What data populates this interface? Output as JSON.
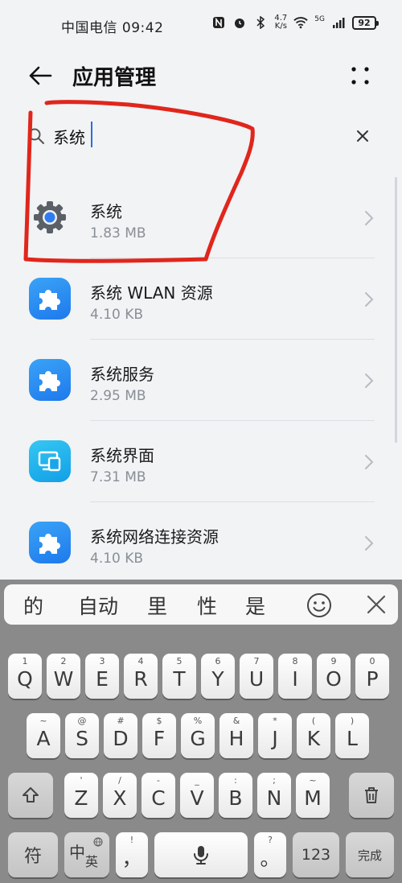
{
  "status_bar": {
    "carrier_time": "中国电信 09:42",
    "net_speed_value": "4.7",
    "net_speed_unit": "K/s",
    "signal_type": "5G",
    "battery": "92"
  },
  "app_bar": {
    "title": "应用管理"
  },
  "search": {
    "value": "系统"
  },
  "apps": [
    {
      "name": "系统",
      "size": "1.83 MB",
      "icon": "gear-icon"
    },
    {
      "name": "系统 WLAN 资源",
      "size": "4.10 KB",
      "icon": "puzzle-icon"
    },
    {
      "name": "系统服务",
      "size": "2.95 MB",
      "icon": "puzzle-icon"
    },
    {
      "name": "系统界面",
      "size": "7.31 MB",
      "icon": "screens-icon"
    },
    {
      "name": "系统网络连接资源",
      "size": "4.10 KB",
      "icon": "puzzle-icon"
    }
  ],
  "keyboard": {
    "candidates": [
      "的",
      "自动",
      "里",
      "性",
      "是"
    ],
    "row1": [
      {
        "main": "Q",
        "sub": "1"
      },
      {
        "main": "W",
        "sub": "2"
      },
      {
        "main": "E",
        "sub": "3"
      },
      {
        "main": "R",
        "sub": "4"
      },
      {
        "main": "T",
        "sub": "5"
      },
      {
        "main": "Y",
        "sub": "6"
      },
      {
        "main": "U",
        "sub": "7"
      },
      {
        "main": "I",
        "sub": "8"
      },
      {
        "main": "O",
        "sub": "9"
      },
      {
        "main": "P",
        "sub": "0"
      }
    ],
    "row2": [
      {
        "main": "A",
        "sub": "~"
      },
      {
        "main": "S",
        "sub": "@"
      },
      {
        "main": "D",
        "sub": "#"
      },
      {
        "main": "F",
        "sub": "$"
      },
      {
        "main": "G",
        "sub": "%"
      },
      {
        "main": "H",
        "sub": "&"
      },
      {
        "main": "J",
        "sub": "*"
      },
      {
        "main": "K",
        "sub": "("
      },
      {
        "main": "L",
        "sub": ")"
      }
    ],
    "row3": [
      {
        "main": "Z",
        "sub": "'"
      },
      {
        "main": "X",
        "sub": "/"
      },
      {
        "main": "C",
        "sub": "-"
      },
      {
        "main": "V",
        "sub": "_"
      },
      {
        "main": "B",
        "sub": ":"
      },
      {
        "main": "N",
        "sub": ";"
      },
      {
        "main": "M",
        "sub": "~"
      }
    ],
    "symbol_key": "符",
    "lang_key_main": "中",
    "lang_key_sub": "英",
    "comma_main": "，",
    "comma_sub": "!",
    "period_main": "。",
    "period_sub": "?",
    "num_key": "123",
    "done_key": "完成"
  },
  "colors": {
    "annotation": "#e0261c",
    "accent": "#2a6dd9"
  }
}
